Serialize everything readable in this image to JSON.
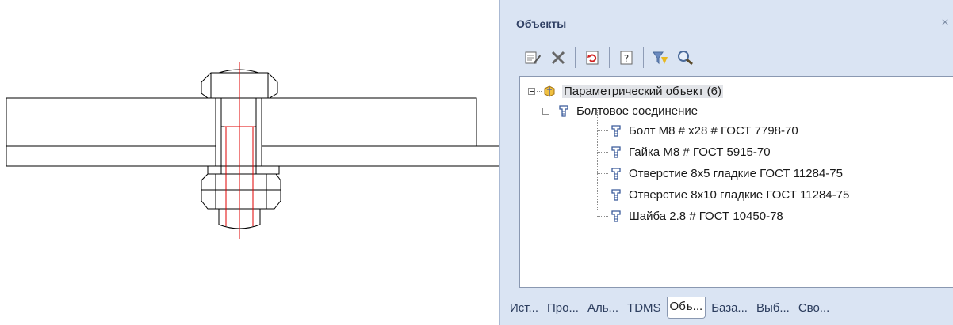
{
  "panel": {
    "title": "Объекты",
    "close_glyph": "×"
  },
  "toolbar": {
    "buttons": [
      {
        "icon": "edit-properties-icon"
      },
      {
        "icon": "delete-icon"
      },
      {
        "icon": "refresh-icon"
      },
      {
        "icon": "help-icon"
      },
      {
        "icon": "filter-icon"
      },
      {
        "icon": "search-icon"
      }
    ]
  },
  "tree": {
    "root": {
      "label": "Параметрический объект (6)",
      "icon": "parametric-object-icon"
    },
    "group": {
      "label": "Болтовое соединение",
      "icon": "bolt-node-icon"
    },
    "items": [
      {
        "label": "Болт М8 # x28 # ГОСТ 7798-70"
      },
      {
        "label": "Гайка М8 # ГОСТ 5915-70"
      },
      {
        "label": "Отверстие 8x5 гладкие ГОСТ 11284-75"
      },
      {
        "label": "Отверстие 8x10 гладкие ГОСТ 11284-75"
      },
      {
        "label": "Шайба 2.8 # ГОСТ 10450-78"
      }
    ]
  },
  "tabs": [
    "Ист...",
    "Про...",
    "Аль...",
    "TDMS",
    "Объ...",
    "База...",
    "Выб...",
    "Сво..."
  ],
  "active_tab": "Объ...",
  "colors": {
    "panel_bg": "#dae4f3",
    "drawing_line": "#000000",
    "axis_line": "#e00000"
  }
}
